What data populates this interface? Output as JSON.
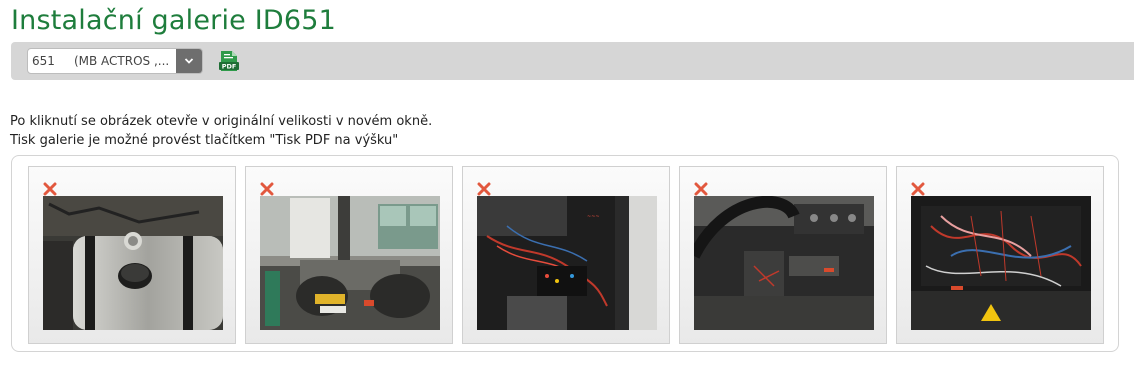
{
  "page": {
    "title": "Instalační galerie ID651"
  },
  "toolbar": {
    "select_value": "651     (MB ACTROS ,...",
    "dropdown_icon": "chevron-down-icon",
    "pdf_icon": "pdf-export-icon"
  },
  "info": {
    "line1": "Po kliknutí se obrázek otevře v originální velikosti v novém okně.",
    "line2": "Tisk galerie je možné provést tlačítkem \"Tisk PDF na výšku\""
  },
  "gallery": {
    "delete_icon": "delete-x-icon",
    "photos": [
      {
        "subject": "fuel-tank"
      },
      {
        "subject": "truck-chassis-in-garage"
      },
      {
        "subject": "dashboard-wiring"
      },
      {
        "subject": "steering-column-wiring"
      },
      {
        "subject": "fuse-box-wiring"
      }
    ]
  },
  "colors": {
    "title_green": "#1e7d3c",
    "toolbar_gray": "#d6d6d6",
    "delete_red": "#e2583e"
  }
}
